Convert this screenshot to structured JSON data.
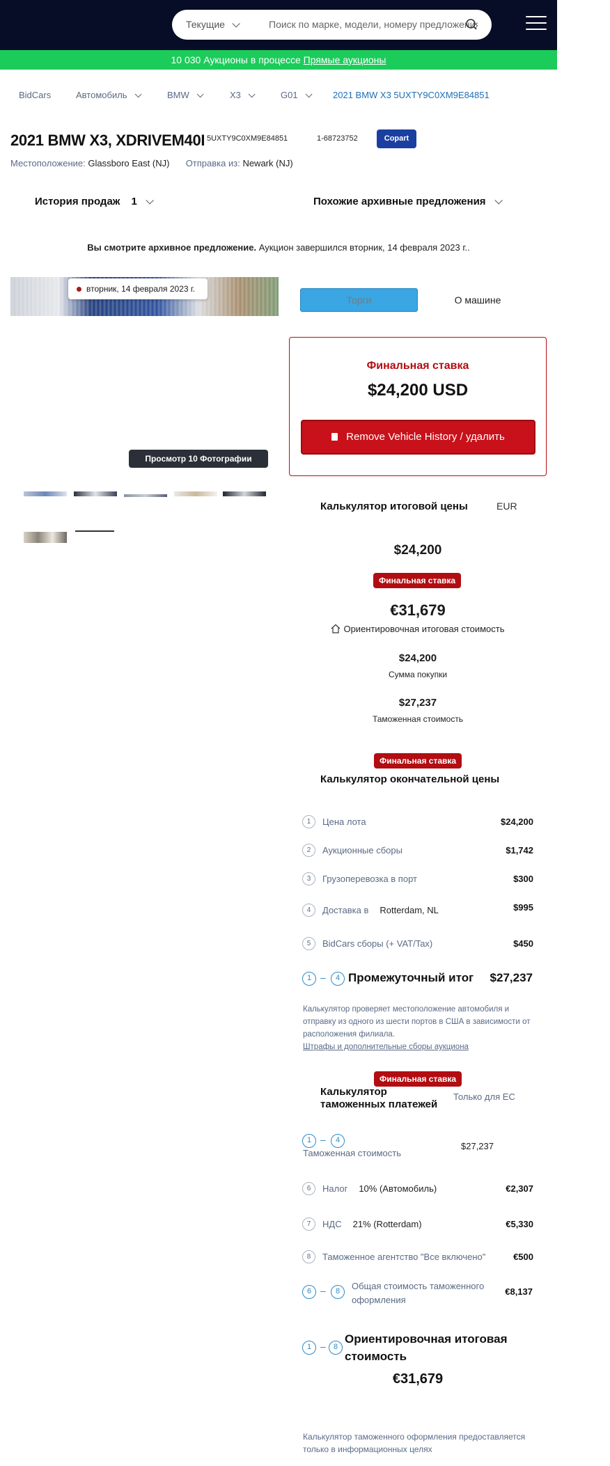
{
  "header": {
    "filter_label": "Текущие",
    "search_placeholder": "Поиск по марке, модели, номеру предложения"
  },
  "banner": {
    "count_text": "10 030 Аукционы в процессе",
    "link_text": "Прямые аукционы"
  },
  "breadcrumb": [
    {
      "label": "BidCars"
    },
    {
      "label": "Автомобиль"
    },
    {
      "label": "BMW"
    },
    {
      "label": "X3"
    },
    {
      "label": "G01"
    },
    {
      "label": "2021 BMW X3 5UXTY9C0XM9E84851"
    }
  ],
  "vehicle": {
    "title": "2021 BMW X3, XDRIVEM40I",
    "vin": "5UXTY9C0XM9E84851",
    "lot": "1-68723752",
    "auction": "Copart",
    "location_label": "Местоположение:",
    "location_value": "Glassboro East (NJ)",
    "ship_label": "Отправка из:",
    "ship_value": "Newark (NJ)"
  },
  "history": {
    "label": "История продаж",
    "count": "1",
    "similar_label": "Похожие архивные предложения"
  },
  "archive_notice": {
    "bold": "Вы смотрите архивное предложение.",
    "text": " Аукцион завершился вторник, 14 февраля 2023 г.."
  },
  "gallery": {
    "date_chip": "вторник, 14 февраля 2023 г.",
    "view_button": "Просмотр 10 Фотографии"
  },
  "tabs": {
    "bids": "Торги",
    "about": "О машине"
  },
  "final_bid": {
    "label": "Финальная ставка",
    "amount": "$24,200 USD",
    "remove_button": "Remove Vehicle History / удалить"
  },
  "calculator": {
    "title": "Калькулятор итоговой цены",
    "currency": "EUR",
    "bid_amount": "$24,200",
    "badge": "Финальная ставка",
    "total_eur": "€31,679",
    "total_label": "Ориентировочная итоговая стоимость",
    "purchase_amount": "$24,200",
    "purchase_label": "Сумма покупки",
    "customs_value": "$27,237",
    "customs_label": "Таможенная стоимость"
  },
  "final_calc": {
    "badge": "Финальная ставка",
    "title": "Калькулятор окончательной цены",
    "rows": [
      {
        "n": "1",
        "label": "Цена лота",
        "value": "$24,200"
      },
      {
        "n": "2",
        "label": "Аукционные сборы",
        "value": "$1,742"
      },
      {
        "n": "3",
        "label": "Грузоперевозка в порт",
        "value": "$300"
      },
      {
        "n": "4",
        "label": "Доставка в",
        "extra": "Rotterdam, NL",
        "value": "$995"
      },
      {
        "n": "5",
        "label": "BidCars сборы (+ VAT/Tax)",
        "value": "$450"
      }
    ],
    "subtotal_from": "1",
    "subtotal_to": "4",
    "subtotal_label": "Промежуточный итог",
    "subtotal_value": "$27,237",
    "note": "Калькулятор проверяет местоположение автомобиля и отправку из одного из шести портов в США в зависимости от расположения филиала.",
    "note_link": "Штрафы и дополнительные сборы аукциона"
  },
  "customs_calc": {
    "badge": "Финальная ставка",
    "title": "Калькулятор таможенных платежей",
    "scope": "Только для ЕС",
    "range_from": "1",
    "range_to": "4",
    "customs_label": "Таможенная стоимость",
    "customs_value": "$27,237",
    "rows": [
      {
        "n": "6",
        "label": "Налог",
        "extra": "10% (Автомобиль)",
        "value": "€2,307"
      },
      {
        "n": "7",
        "label": "НДС",
        "extra": "21% (Rotterdam)",
        "value": "€5,330"
      },
      {
        "n": "8",
        "label": "Таможенное агентство \"Все включено\"",
        "value": "€500"
      }
    ],
    "total_from": "6",
    "total_to": "8",
    "total_label": "Общая стоимость таможенного оформления",
    "total_value": "€8,137",
    "final_from": "1",
    "final_to": "8",
    "final_label": "Ориентировочная итоговая стоимость",
    "final_value": "€31,679",
    "footnote": "Калькулятор таможенного оформления предоставляется только в информационных целях"
  },
  "colors": {
    "header_bg": "#070d26",
    "banner_green": "#1ccc5b",
    "accent_red": "#b20d12",
    "accent_blue": "#2e8ac8",
    "copart_blue": "#1b3fa0"
  }
}
